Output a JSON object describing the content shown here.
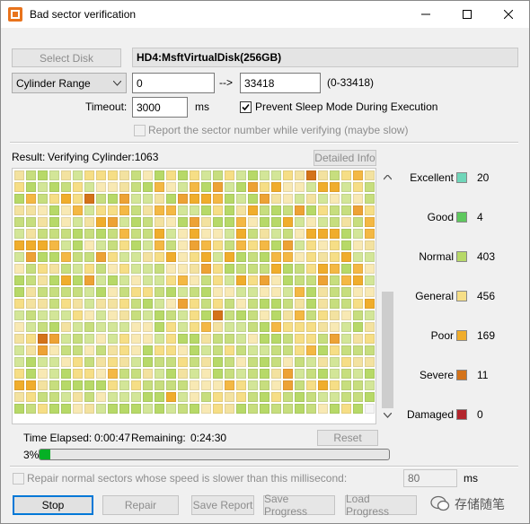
{
  "window": {
    "title": "Bad sector verification"
  },
  "toolbar": {
    "select_disk": "Select Disk",
    "disk_name": "HD4:MsftVirtualDisk(256GB)",
    "range_mode": "Cylinder Range",
    "range_start": "0",
    "arrow": "-->",
    "range_end": "33418",
    "range_hint": "(0-33418)",
    "timeout_label": "Timeout:",
    "timeout_value": "3000",
    "timeout_unit": "ms",
    "prevent_sleep": "Prevent Sleep Mode During Execution",
    "report_sector": "Report the sector number while verifying (maybe slow)"
  },
  "result": {
    "label": "Result:",
    "status": "Verifying Cylinder:1063",
    "detailed_info": "Detailed Info"
  },
  "legend": [
    {
      "name": "Excellent",
      "color": "#6fd6b9",
      "count": "20"
    },
    {
      "name": "Good",
      "color": "#5ec85e",
      "count": "4"
    },
    {
      "name": "Normal",
      "color": "#b7d968",
      "count": "403"
    },
    {
      "name": "General",
      "color": "#f6de86",
      "count": "456"
    },
    {
      "name": "Poor",
      "color": "#f0ad2c",
      "count": "169"
    },
    {
      "name": "Severe",
      "color": "#d4731a",
      "count": "11"
    },
    {
      "name": "Damaged",
      "color": "#b3252c",
      "count": "0"
    }
  ],
  "status": {
    "elapsed_label": "Time Elapsed:",
    "elapsed": "0:00:47",
    "remaining_label": "Remaining:",
    "remaining": "0:24:30",
    "reset": "Reset",
    "percent": "3%",
    "progress_fraction": 0.03
  },
  "repair_option": {
    "label": "Repair normal sectors whose speed is slower than this millisecond:",
    "value": "80",
    "unit": "ms"
  },
  "buttons": {
    "stop": "Stop",
    "repair": "Repair",
    "save_report": "Save Report",
    "save_progress": "Save Progress",
    "load_progress": "Load Progress"
  },
  "watermark": "存储随笔"
}
